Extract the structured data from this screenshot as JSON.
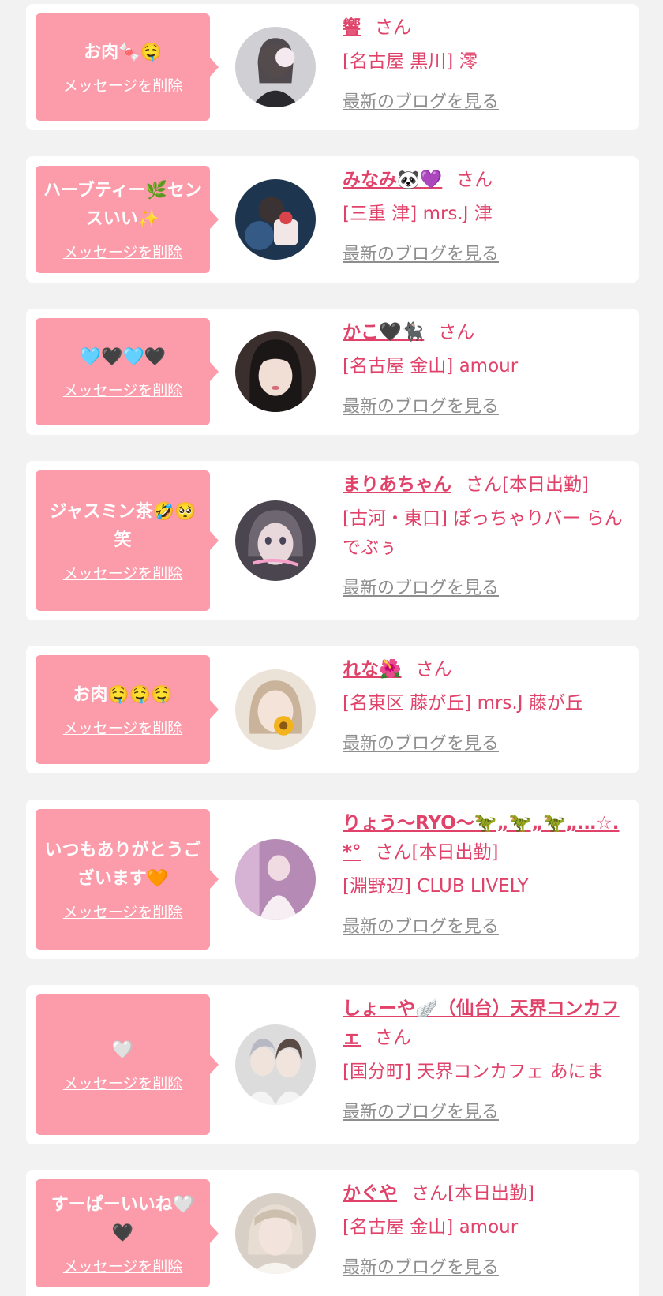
{
  "accent_color": "#e0426a",
  "bubble_color": "#fc9caa",
  "messages": [
    {
      "message": "お肉🍬🤤",
      "delete_label": "メッセージを削除",
      "name": "響",
      "honorific": "さん",
      "status": "",
      "shop": "[名古屋 黒川] 澪",
      "blog_label": "最新のブログを見る",
      "avatar_icon": "girl-avatar-icon"
    },
    {
      "message": "ハーブティー🌿センスいい✨",
      "delete_label": "メッセージを削除",
      "name": "みなみ🐼💜",
      "honorific": "さん",
      "status": "",
      "shop": "[三重 津] mrs.J 津",
      "blog_label": "最新のブログを見る",
      "avatar_icon": "girl-avatar-icon"
    },
    {
      "message": "🩵🖤🩵🖤",
      "delete_label": "メッセージを削除",
      "name": "かこ🖤🐈‍⬛",
      "honorific": "さん",
      "status": "",
      "shop": "[名古屋 金山] amour",
      "blog_label": "最新のブログを見る",
      "avatar_icon": "girl-avatar-icon"
    },
    {
      "message": "ジャスミン茶🤣🥺笑",
      "delete_label": "メッセージを削除",
      "name": "まりあちゃん",
      "honorific": "さん",
      "status": "[本日出勤]",
      "shop": "[古河・東口] ぽっちゃりバー らんでぶぅ",
      "blog_label": "最新のブログを見る",
      "avatar_icon": "girl-avatar-icon"
    },
    {
      "message": "お肉🤤🤤🤤",
      "delete_label": "メッセージを削除",
      "name": "れな🌺",
      "honorific": "さん",
      "status": "",
      "shop": "[名東区 藤が丘] mrs.J 藤が丘",
      "blog_label": "最新のブログを見る",
      "avatar_icon": "girl-avatar-icon"
    },
    {
      "message": "いつもありがとうございます🧡",
      "delete_label": "メッセージを削除",
      "name": "りょう〜RYO〜🦖„🦖„🦖„…☆.*°",
      "honorific": "さん",
      "status": "[本日出勤]",
      "shop": "[淵野辺] CLUB LIVELY",
      "blog_label": "最新のブログを見る",
      "avatar_icon": "girl-avatar-icon"
    },
    {
      "message": "🤍",
      "delete_label": "メッセージを削除",
      "name": "しょーや🪽（仙台）天界コンカフェ",
      "honorific": "さん",
      "status": "",
      "shop": "[国分町] 天界コンカフェ あにま",
      "blog_label": "最新のブログを見る",
      "avatar_icon": "girl-avatar-icon"
    },
    {
      "message": "すーぱーいいね🤍🖤",
      "delete_label": "メッセージを削除",
      "name": "かぐや",
      "honorific": "さん",
      "status": "[本日出勤]",
      "shop": "[名古屋 金山] amour",
      "blog_label": "最新のブログを見る",
      "avatar_icon": "girl-avatar-icon"
    }
  ]
}
